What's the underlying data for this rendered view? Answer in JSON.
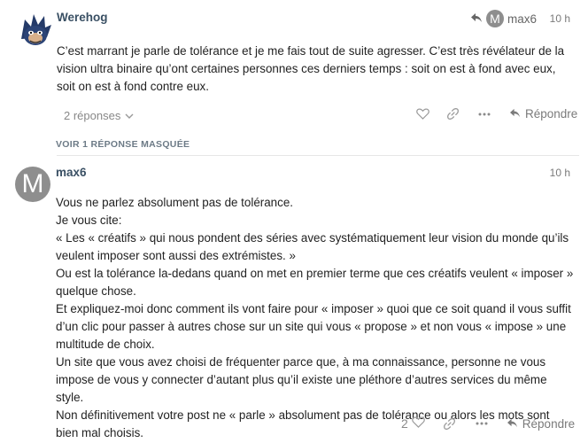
{
  "post1": {
    "username": "Werehog",
    "reply_to": {
      "avatar_letter": "M",
      "username": "max6"
    },
    "time": "10 h",
    "body": "C’est marrant je parle de tolérance et je me fais tout de suite agresser. C’est très révélateur de la vision ultra binaire qu’ont certaines personnes ces derniers temps : soit on est à fond avec eux, soit on est à fond contre eux.",
    "replies_label": "2 réponses",
    "reply_label": "Répondre"
  },
  "hidden_replies_label": "VOIR 1 RÉPONSE MASQUÉE",
  "post2": {
    "avatar_letter": "M",
    "username": "max6",
    "time": "10 h",
    "lines": [
      "Vous ne parlez absolument pas de tolérance.",
      "Je vous cite:",
      "« Les « créatifs » qui nous pondent des séries avec systématiquement leur vision du monde qu’ils veulent imposer sont aussi des extrémistes. »",
      "Ou est la tolérance la-dedans quand on met en premier terme que ces créatifs veulent « imposer » quelque chose.",
      "Et expliquez-moi donc comment ils vont faire pour « imposer » quoi que ce soit quand il vous suffit d’un clic pour passer à autres chose sur un site qui vous « propose » et non vous « impose » une multitude de choix.",
      "Un site que vous avez choisi de fréquenter parce que, à ma connaissance, personne ne vous impose de vous y connecter d’autant plus qu’il existe une pléthore d’autres services du même style.",
      "Non définitivement votre post ne « parle » absolument pas de tolérance ou alors les mots sont bien mal choisis."
    ],
    "like_count": "2",
    "reply_label": "Répondre"
  },
  "icons": {
    "reply_arrow": "reply-arrow-icon",
    "heart": "heart-icon",
    "link": "link-icon",
    "more": "more-icon",
    "chevron": "chevron-down-icon"
  },
  "colors": {
    "username": "#3a5064",
    "muted": "#8e8e8e",
    "avatar_grey": "#8e8e8e",
    "divider": "#e6e6e6"
  }
}
